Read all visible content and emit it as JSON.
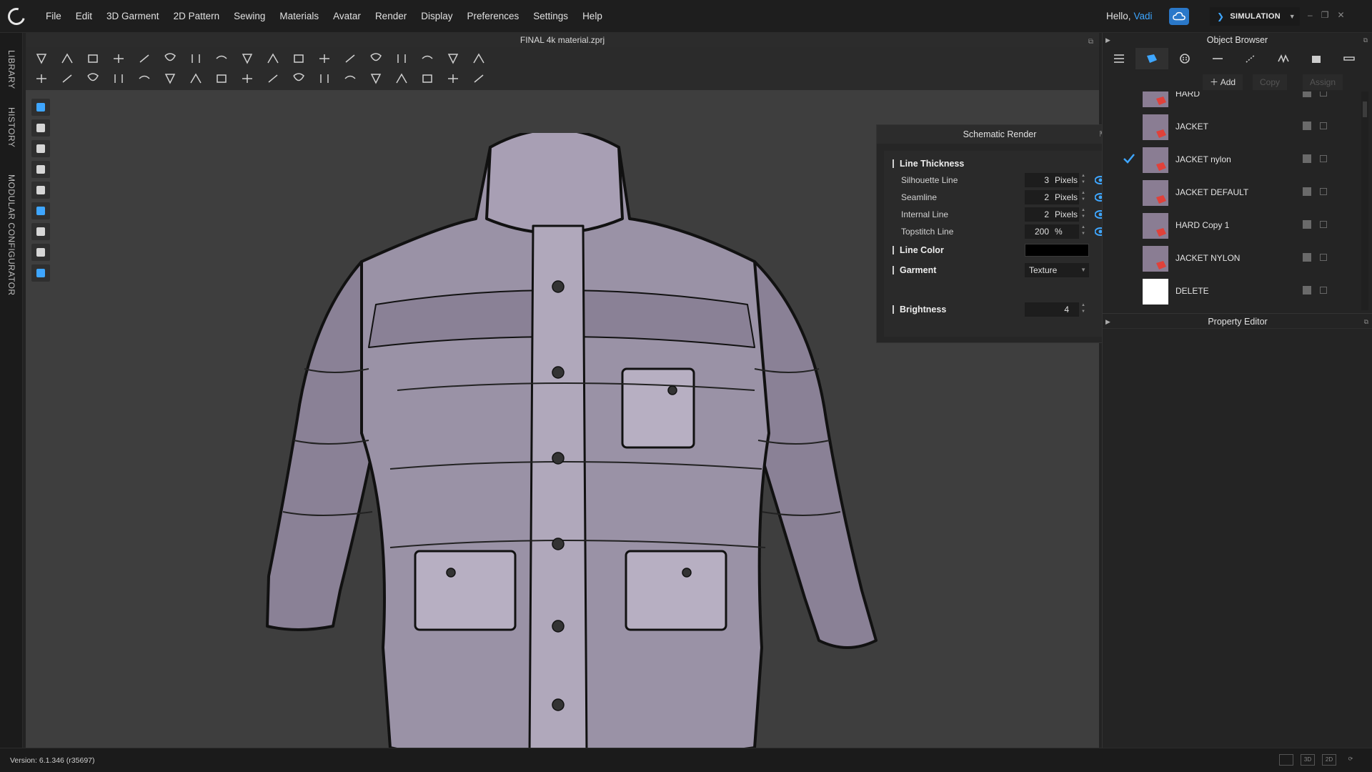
{
  "menubar": {
    "items": [
      "File",
      "Edit",
      "3D Garment",
      "2D Pattern",
      "Sewing",
      "Materials",
      "Avatar",
      "Render",
      "Display",
      "Preferences",
      "Settings",
      "Help"
    ],
    "greeting": "Hello,",
    "user": "Vadi",
    "mode": "SIMULATION"
  },
  "left_tabs": [
    "LIBRARY",
    "HISTORY",
    "MODULAR CONFIGURATOR"
  ],
  "viewport": {
    "file_title": "FINAL 4k material.zprj"
  },
  "schematic": {
    "title": "Schematic Render",
    "sections": {
      "line_thickness": "Line Thickness",
      "line_color": "Line Color",
      "garment": "Garment",
      "brightness": "Brightness"
    },
    "rows": [
      {
        "label": "Silhouette Line",
        "value": "3",
        "unit": "Pixels"
      },
      {
        "label": "Seamline",
        "value": "2",
        "unit": "Pixels"
      },
      {
        "label": "Internal Line",
        "value": "2",
        "unit": "Pixels"
      },
      {
        "label": "Topstitch Line",
        "value": "200",
        "unit": "%"
      }
    ],
    "line_color_value": "#000000",
    "garment_value": "Texture",
    "brightness_value": "4",
    "eye_color": "#3ea6ff"
  },
  "object_browser": {
    "title": "Object Browser",
    "add_label": "Add",
    "copy_label": "Copy",
    "assign_label": "Assign",
    "items": [
      {
        "name": "HARD",
        "checked": false,
        "white": false
      },
      {
        "name": "JACKET",
        "checked": false,
        "white": false
      },
      {
        "name": "JACKET nylon",
        "checked": true,
        "white": false
      },
      {
        "name": "JACKET DEFAULT",
        "checked": false,
        "white": false
      },
      {
        "name": "HARD Copy 1",
        "checked": false,
        "white": false
      },
      {
        "name": "JACKET NYLON",
        "checked": false,
        "white": false
      },
      {
        "name": "DELETE",
        "checked": false,
        "white": true
      }
    ]
  },
  "property_editor": {
    "title": "Property Editor"
  },
  "status": {
    "version": "Version: 6.1.346 (r35697)"
  },
  "colors": {
    "accent": "#3ea6ff",
    "jacket": "#8c8398",
    "background": "#3e3e3e"
  }
}
